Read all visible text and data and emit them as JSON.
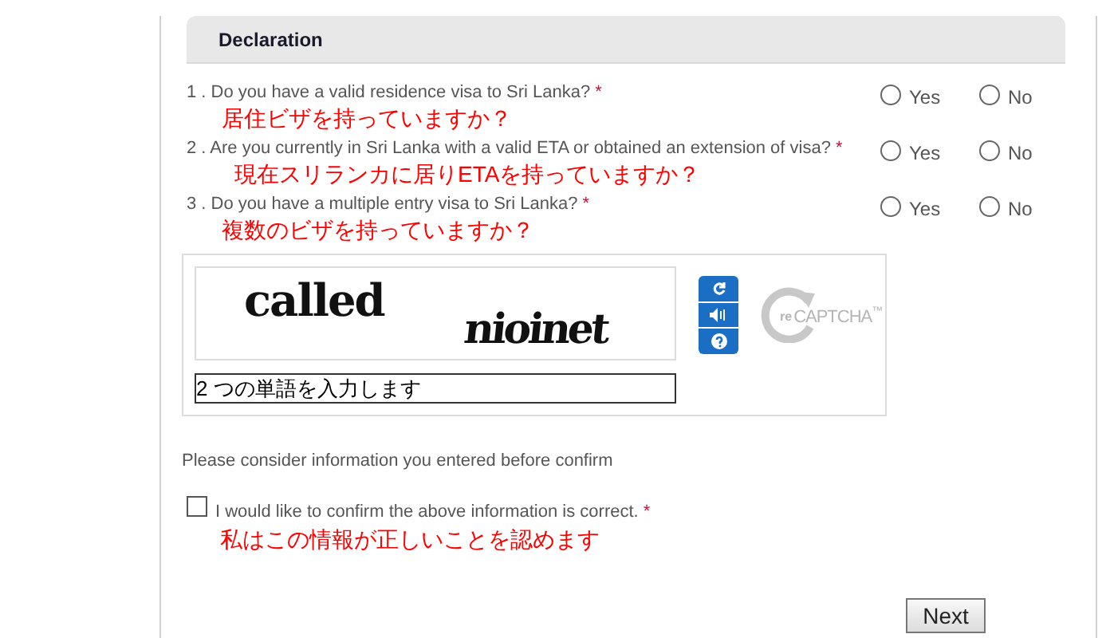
{
  "section": {
    "title": "Declaration"
  },
  "questions": [
    {
      "text": "1 . Do you have a valid residence visa to Sri Lanka?",
      "required": "*",
      "note": "居住ビザを持っていますか？",
      "options": [
        {
          "label": "Yes",
          "selected": false
        },
        {
          "label": "No",
          "selected": false
        }
      ]
    },
    {
      "text": "2 . Are you currently in Sri Lanka with a valid ETA or obtained an extension of visa?",
      "required": "*",
      "note": "現在スリランカに居りETAを持っていますか？",
      "options": [
        {
          "label": "Yes",
          "selected": false
        },
        {
          "label": "No",
          "selected": false
        }
      ]
    },
    {
      "text": "3 . Do you have a multiple entry visa to Sri Lanka?",
      "required": "*",
      "note": "複数のビザを持っていますか？",
      "options": [
        {
          "label": "Yes",
          "selected": false
        },
        {
          "label": "No",
          "selected": false
        }
      ]
    }
  ],
  "captcha": {
    "words": [
      "called",
      "nioinet"
    ],
    "input_value": "2 つの単語を入力します",
    "logo_prefix": "re",
    "logo": "CAPTCHA",
    "logo_tm": "™"
  },
  "notice": "Please consider information you entered before confirm",
  "confirm": {
    "text": "I would like to confirm the above information is correct.",
    "required": "*",
    "note": "私はこの情報が正しいことを認めます",
    "checked": false
  },
  "buttons": [
    "Next"
  ]
}
